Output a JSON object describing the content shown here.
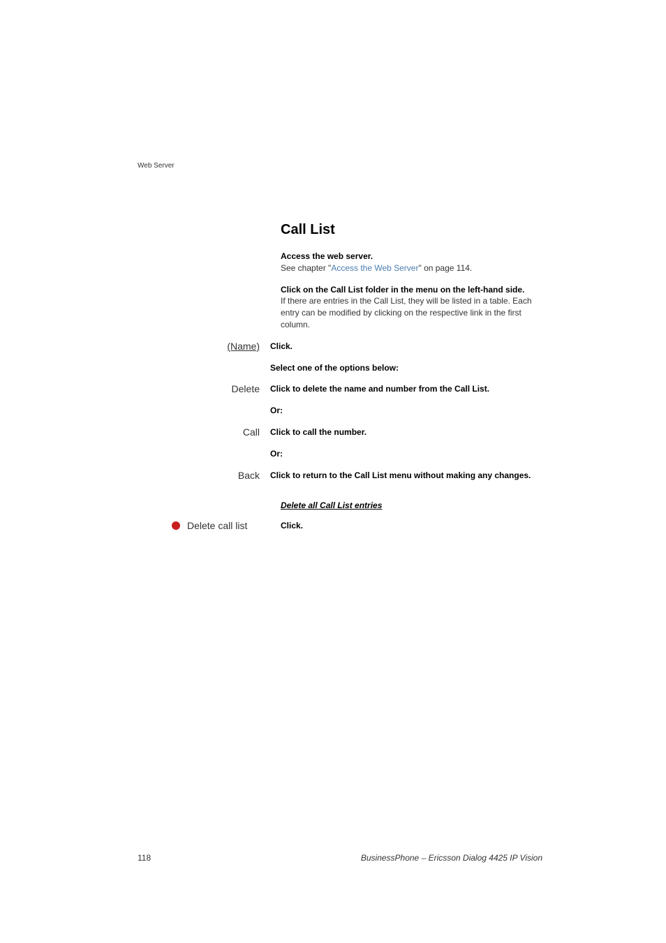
{
  "header": {
    "label": "Web Server"
  },
  "heading": "Call List",
  "intro": {
    "bold1": "Access the web server.",
    "reg_prefix": "See chapter \"",
    "link": "Access the Web Server",
    "reg_suffix": "\" on page 114."
  },
  "para2": {
    "bold": "Click on the Call List folder in the menu on the left-hand side.",
    "reg": "If there are entries in the Call List, they will be listed in a table. Each entry can be modified by clicking on the respective link in the first column."
  },
  "rows": {
    "name": {
      "label": "(Name)",
      "desc": "Click."
    },
    "select": {
      "desc": "Select one of the options below:"
    },
    "delete": {
      "label": "Delete",
      "desc": "Click to delete the name and number from the Call List."
    },
    "or1": {
      "desc": "Or:"
    },
    "call": {
      "label": "Call",
      "desc": "Click to call the number."
    },
    "or2": {
      "desc": "Or:"
    },
    "back": {
      "label": "Back",
      "desc": "Click to return to the Call List menu without making any changes."
    }
  },
  "subheading": "Delete all Call List entries",
  "deleteAll": {
    "label": "Delete call list",
    "desc": "Click."
  },
  "footer": {
    "page": "118",
    "title": "BusinessPhone – Ericsson Dialog 4425 IP Vision"
  }
}
